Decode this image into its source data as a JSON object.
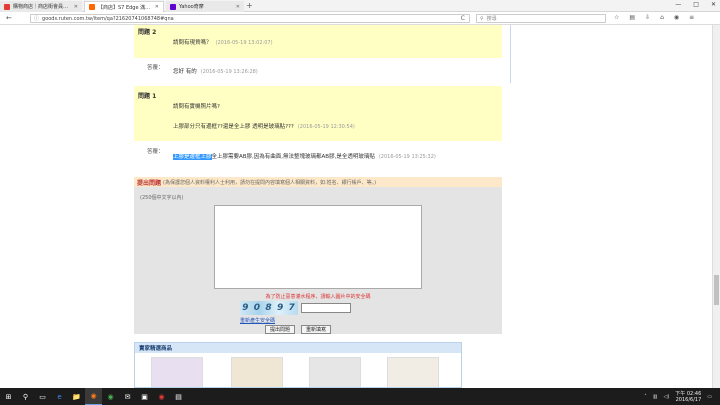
{
  "browser": {
    "tabs": [
      {
        "label": "購物商店｜商店街會員優惠",
        "favicon_color": "#e53935",
        "active": false
      },
      {
        "label": "【商店】S7 Edge 滿版玻璃貼",
        "favicon_color": "#ff6600",
        "active": true
      },
      {
        "label": "Yahoo奇摩",
        "favicon_color": "#5f01d1",
        "active": false
      }
    ],
    "new_tab": "+",
    "window_controls": {
      "minimize": "—",
      "maximize": "□",
      "close": "✕"
    },
    "url": "goods.ruten.com.tw/item/qa?21620741068748#qna",
    "search_placeholder": "搜尋",
    "nav": {
      "back": "←",
      "info": "ⓘ",
      "reload": "C"
    }
  },
  "qa": [
    {
      "label": "問題 2",
      "question_lines": [
        {
          "text": "請問有現貨嗎？",
          "time": "(2016-05-19 13:02:07)"
        }
      ],
      "answer_label": "答覆：",
      "answer": {
        "text": "您好 有的",
        "time": "(2016-05-19 13:26:28)"
      }
    },
    {
      "label": "問題 1",
      "question_lines": [
        {
          "text": "請問有實機照片嗎?",
          "time": ""
        },
        {
          "text": "上膠部分只有邊框??還是全上膠 透明是玻璃貼???",
          "time": "(2016-05-19 12:30:54)"
        }
      ],
      "answer_label": "答覆：",
      "answer": {
        "highlight": "上膠是邊框上膠",
        "text": "全上膠需要AB膠,因為有曲面,無法整塊玻璃都AB膠,是全透明玻璃貼",
        "time": "(2016-05-19 13:25:32)"
      }
    }
  ],
  "ask": {
    "title": "提出問題",
    "note": "(為保護您個人資料權利人士利用，請勿在提問內容填寫個人相關資料，如:姓名、銀行帳戶、等。)",
    "limit": "(250個中文字以內)",
    "warning": "為了防止惡意灌水程序，請輸入圖片中的安全碼",
    "captcha": [
      "9",
      "0",
      "8",
      "9",
      "7"
    ],
    "refresh_link": "重新產生安全碼",
    "submit": "提出問題",
    "reset": "重新填寫"
  },
  "recommend": {
    "title": "賣家精選商品",
    "items": [
      {
        "color": "#e8e0f0"
      },
      {
        "color": "#f0e6d4"
      },
      {
        "color": "#e6e6e6"
      },
      {
        "color": "#f2ede4"
      }
    ]
  },
  "taskbar": {
    "start": "⊞",
    "icons": [
      "⚲",
      "▭",
      "e",
      "📁",
      "◉",
      "◉",
      "✉",
      "▣",
      "◉",
      "▤"
    ],
    "time": "下午 02:46",
    "date": "2016/6/17"
  }
}
